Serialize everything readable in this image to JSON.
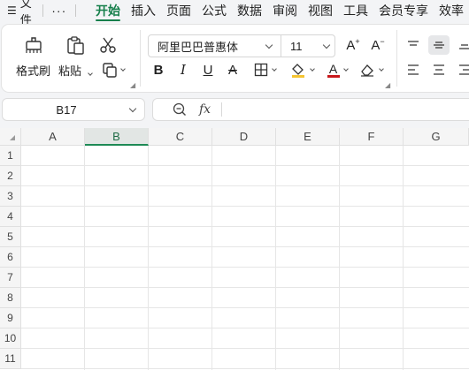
{
  "menubar": {
    "file_label": "文件",
    "more_label": "···",
    "tabs": [
      {
        "label": "开始",
        "active": true
      },
      {
        "label": "插入"
      },
      {
        "label": "页面"
      },
      {
        "label": "公式"
      },
      {
        "label": "数据"
      },
      {
        "label": "审阅"
      },
      {
        "label": "视图"
      },
      {
        "label": "工具"
      },
      {
        "label": "会员专享"
      },
      {
        "label": "效率"
      }
    ]
  },
  "ribbon": {
    "format_painter_label": "格式刷",
    "paste_label": "粘贴",
    "font_name": "阿里巴巴普惠体",
    "font_size": "11",
    "bold_label": "B",
    "italic_label": "I",
    "underline_label": "U",
    "strike_label": "A",
    "font_color_label": "A",
    "grow_label": "A",
    "shrink_label": "A",
    "fill_color": "#f5c431",
    "font_color": "#c8191c",
    "accent_color": "#167f4b"
  },
  "formula_bar": {
    "cell_ref": "B17",
    "fx_label": "fx",
    "value": ""
  },
  "grid": {
    "columns": [
      "A",
      "B",
      "C",
      "D",
      "E",
      "F",
      "G"
    ],
    "selected_column": "B",
    "rows": [
      "1",
      "2",
      "3",
      "4",
      "5",
      "6",
      "7",
      "8",
      "9",
      "10",
      "11"
    ]
  }
}
